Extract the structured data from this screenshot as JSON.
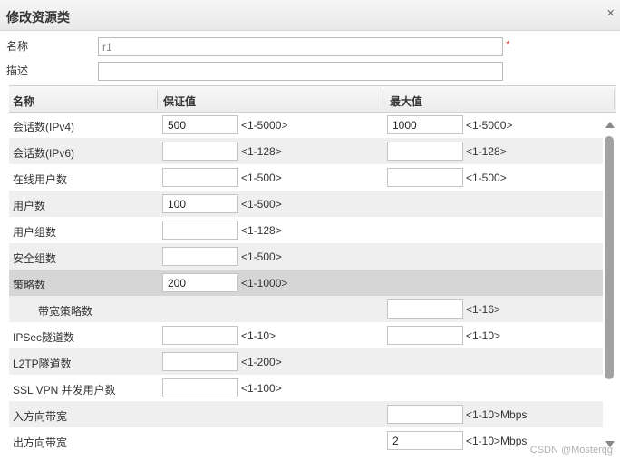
{
  "dialog": {
    "title": "修改资源类",
    "close_glyph": "×"
  },
  "form": {
    "name_label": "名称",
    "name_value": "r1",
    "required_mark": "*",
    "desc_label": "描述",
    "desc_value": ""
  },
  "table": {
    "headers": [
      "名称",
      "保证值",
      "最大值"
    ],
    "rows": [
      {
        "name": "会话数(IPv4)",
        "guarantee": "500",
        "g_range": "<1-5000>",
        "max": "1000",
        "m_range": "<1-5000>"
      },
      {
        "name": "会话数(IPv6)",
        "guarantee": "",
        "g_range": "<1-128>",
        "max": "",
        "m_range": "<1-128>"
      },
      {
        "name": "在线用户数",
        "guarantee": "",
        "g_range": "<1-500>",
        "max": "",
        "m_range": "<1-500>"
      },
      {
        "name": "用户数",
        "guarantee": "100",
        "g_range": "<1-500>"
      },
      {
        "name": "用户组数",
        "guarantee": "",
        "g_range": "<1-128>"
      },
      {
        "name": "安全组数",
        "guarantee": "",
        "g_range": "<1-500>"
      },
      {
        "name": "策略数",
        "guarantee": "200",
        "g_range": "<1-1000>"
      },
      {
        "name": "带宽策略数",
        "max": "",
        "m_range": "<1-16>"
      },
      {
        "name": "IPSec隧道数",
        "guarantee": "",
        "g_range": "<1-10>",
        "max": "",
        "m_range": "<1-10>"
      },
      {
        "name": "L2TP隧道数",
        "guarantee": "",
        "g_range": "<1-200>"
      },
      {
        "name": "SSL VPN 并发用户数",
        "guarantee": "",
        "g_range": "<1-100>"
      },
      {
        "name": "入方向带宽",
        "max": "",
        "m_range": "<1-10>Mbps"
      },
      {
        "name": "出方向带宽",
        "max": "2",
        "m_range": "<1-10>Mbps"
      }
    ]
  },
  "watermark": "CSDN @Mosterqg"
}
